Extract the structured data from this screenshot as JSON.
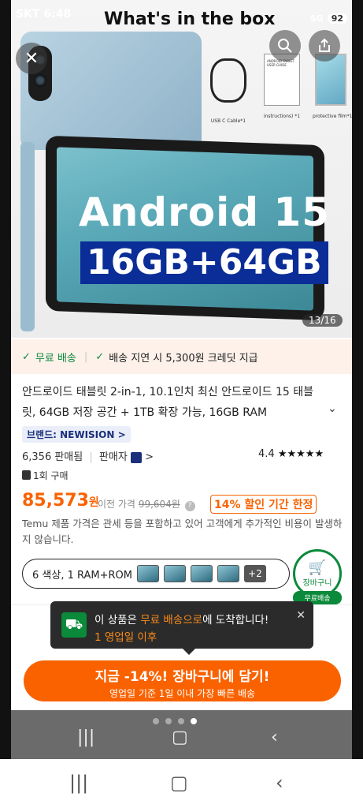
{
  "status_bar": {
    "carrier": "SKT",
    "time": "6:48",
    "network": "5G",
    "battery": "92"
  },
  "hero": {
    "box_title": "What's in the box",
    "accessories": [
      {
        "label": "USB C Cable*1"
      },
      {
        "label": "instructions) *1",
        "sheet_text": "ANDROID TABLET USER GUIDE"
      },
      {
        "label": "protective film*1"
      }
    ],
    "headline": "Android 15",
    "spec": "16GB+64GB",
    "page_counter": "13/16",
    "icons": {
      "close": "close-icon",
      "search": "search-icon",
      "share": "share-icon"
    }
  },
  "shipping": {
    "free_shipping": "무료 배송",
    "delay_credit": "배송 지연 시 5,300원 크레딧 지급"
  },
  "product": {
    "title": "안드로이드 태블릿 2-in-1, 10.1인치 최신 안드로이드 15 태블릿, 64GB 저장 공간 + 1TB 확장 가능, 16GB RAM",
    "brand": "브랜드: NEWISION >",
    "sold": "6,356 판매됨",
    "seller": "판매자",
    "rating": "4.4",
    "stars": "★★★★★",
    "bought": "1회 구매",
    "price": "85,573",
    "price_unit": "원",
    "prev_price_label": "이전 가격",
    "prev_price": "99,604원",
    "discount": "14% 할인 기간 한정",
    "notice": "Temu 제품 가격은 관세 등을 포함하고 있어 고객에게 추가적인 비용이 발생하지 않습니다.",
    "variant": "6 색상, 1 RAM+ROM",
    "variant_more": "+2",
    "cart_label": "장바구니",
    "cart_free": "무료배송"
  },
  "toast": {
    "line1_prefix": "이 상품은",
    "line1_highlight": "무료 배송으로",
    "line1_suffix": "에 도착합니다!",
    "line2": "1 영업일 이후"
  },
  "cta": {
    "main": "지금 -14%! 장바구니에 담기!",
    "sub": "영업일 기준 1일 이내 가장 빠른 배송"
  },
  "colors": {
    "accent": "#fa6200",
    "green": "#0a8a3a",
    "brand_blue": "#1b2f7a"
  }
}
